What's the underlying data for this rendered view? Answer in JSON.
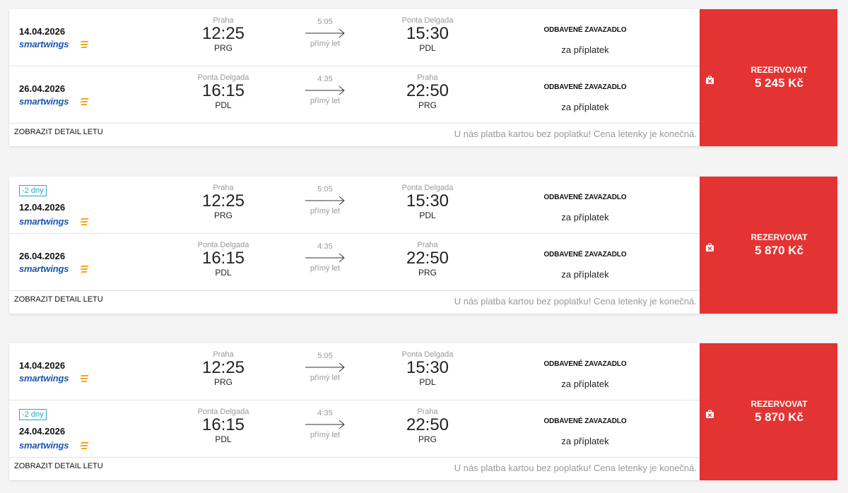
{
  "common": {
    "detail_label": "ZOBRAZIT DETAIL LETU",
    "note": "U nás platba kartou bez poplatku! Cena letenky je konečná.",
    "book_label": "REZERVOVAT",
    "bag_title": "ODBAVENÉ ZAVAZADLO",
    "bag_fee": "za příplatek",
    "airline": "smartwings",
    "flight_type": "přímý let",
    "accent_color": "#e43333",
    "badge_color": "#2aa3c9",
    "logo_color": "#1b57b0"
  },
  "offers": [
    {
      "price": "5 245 Kč",
      "legs": [
        {
          "date": "14.04.2026",
          "badge": "",
          "dep_city": "Praha",
          "dep_time": "12:25",
          "dep_code": "PRG",
          "duration": "5:05",
          "arr_city": "Ponta Delgada",
          "arr_time": "15:30",
          "arr_code": "PDL"
        },
        {
          "date": "26.04.2026",
          "badge": "",
          "dep_city": "Ponta Delgada",
          "dep_time": "16:15",
          "dep_code": "PDL",
          "duration": "4:35",
          "arr_city": "Praha",
          "arr_time": "22:50",
          "arr_code": "PRG"
        }
      ]
    },
    {
      "price": "5 870 Kč",
      "legs": [
        {
          "date": "12.04.2026",
          "badge": "-2 dny",
          "dep_city": "Praha",
          "dep_time": "12:25",
          "dep_code": "PRG",
          "duration": "5:05",
          "arr_city": "Ponta Delgada",
          "arr_time": "15:30",
          "arr_code": "PDL"
        },
        {
          "date": "26.04.2026",
          "badge": "",
          "dep_city": "Ponta Delgada",
          "dep_time": "16:15",
          "dep_code": "PDL",
          "duration": "4:35",
          "arr_city": "Praha",
          "arr_time": "22:50",
          "arr_code": "PRG"
        }
      ]
    },
    {
      "price": "5 870 Kč",
      "legs": [
        {
          "date": "14.04.2026",
          "badge": "",
          "dep_city": "Praha",
          "dep_time": "12:25",
          "dep_code": "PRG",
          "duration": "5:05",
          "arr_city": "Ponta Delgada",
          "arr_time": "15:30",
          "arr_code": "PDL"
        },
        {
          "date": "24.04.2026",
          "badge": "-2 dny",
          "dep_city": "Ponta Delgada",
          "dep_time": "16:15",
          "dep_code": "PDL",
          "duration": "4:35",
          "arr_city": "Praha",
          "arr_time": "22:50",
          "arr_code": "PRG"
        }
      ]
    }
  ]
}
